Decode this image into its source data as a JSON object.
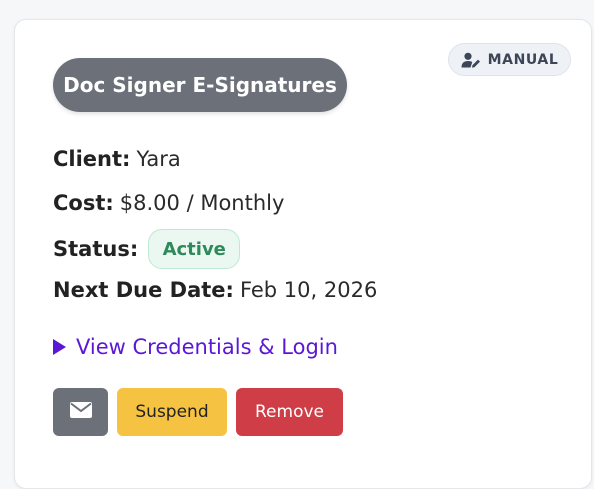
{
  "card": {
    "mode_badge": {
      "label": "MANUAL",
      "icon": "user-edit-icon"
    },
    "service_name": "Doc Signer E-Signatures",
    "fields": {
      "client": {
        "label": "Client:",
        "value": "Yara"
      },
      "cost": {
        "label": "Cost:",
        "value": "$8.00 / Monthly"
      },
      "status": {
        "label": "Status:",
        "value": "Active"
      },
      "next_due": {
        "label": "Next Due Date:",
        "value": "Feb 10, 2026"
      }
    },
    "credentials_toggle": "View Credentials & Login",
    "actions": {
      "email_icon": "envelope-icon",
      "suspend_label": "Suspend",
      "remove_label": "Remove"
    }
  },
  "colors": {
    "pill_bg": "#6b7079",
    "status_green": "#2f8a5b",
    "link_purple": "#5b17d6",
    "suspend_yellow": "#f5c242",
    "remove_red": "#cf3d46"
  }
}
